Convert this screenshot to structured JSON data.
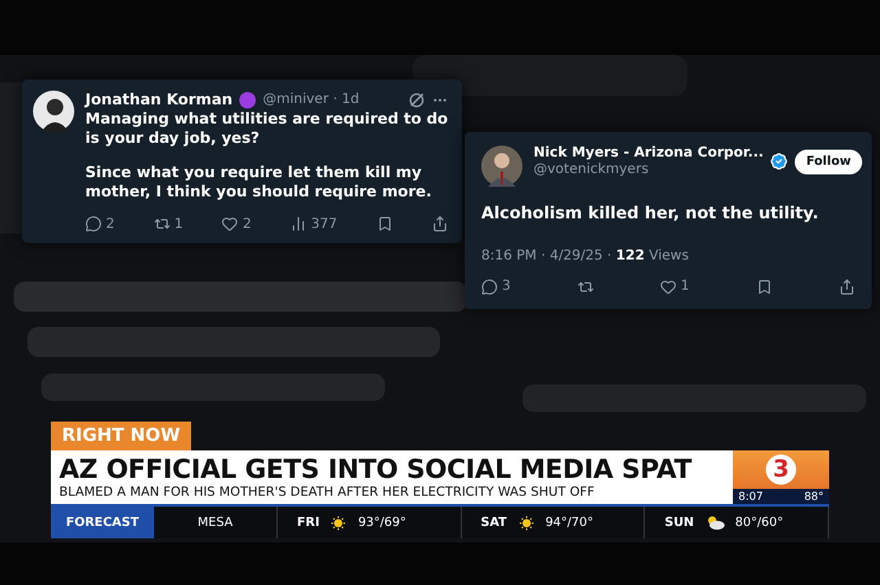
{
  "tweets": [
    {
      "kind": "compact",
      "author": "Jonathan Korman",
      "handle": "@miniver · 1d",
      "badge": true,
      "verified": false,
      "paragraphs": [
        "Managing what utilities are required to do is your day job, yes?",
        "Since what you require let them kill my mother, I think you should require more."
      ],
      "stats": {
        "replies": "2",
        "reposts": "1",
        "likes": "2",
        "views": "377"
      }
    },
    {
      "kind": "detail",
      "author": "Nick Myers - Arizona Corpor...",
      "handle": "@votenickmyers",
      "badge": false,
      "verified": true,
      "follow": "Follow",
      "paragraphs": [
        "Alcoholism killed her, not the utility."
      ],
      "meta": "8:16 PM · 4/29/25 · ",
      "views": "122",
      "views_label": "Views",
      "stats": {
        "replies": "3",
        "likes": "1"
      }
    }
  ],
  "lower_third": {
    "tag": "RIGHT NOW",
    "headline": "AZ OFFICIAL GETS INTO SOCIAL MEDIA SPAT",
    "subhead": "BLAMED A MAN FOR HIS MOTHER'S DEATH AFTER HER ELECTRICITY WAS SHUT OFF",
    "logo": "3",
    "time": "8:07",
    "temperature": "88°"
  },
  "forecast": {
    "label": "FORECAST",
    "city": "MESA",
    "days": [
      {
        "day": "FRI",
        "kind": "sunny",
        "temps": "93°/69°"
      },
      {
        "day": "SAT",
        "kind": "sunny",
        "temps": "94°/70°"
      },
      {
        "day": "SUN",
        "kind": "cloudy",
        "temps": "80°/60°"
      }
    ]
  }
}
